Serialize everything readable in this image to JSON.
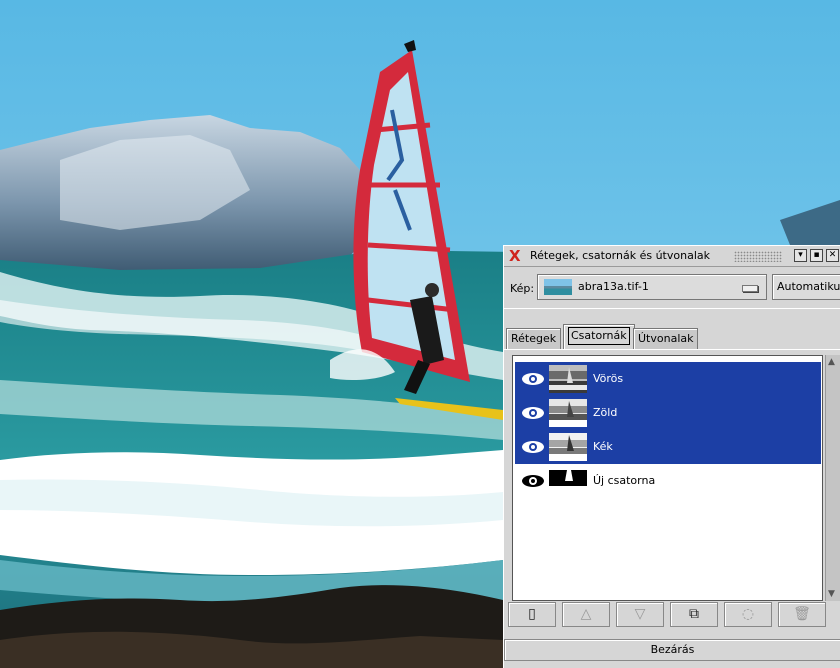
{
  "window": {
    "title": "Rétegek, csatornák és útvonalak",
    "image_label": "Kép:",
    "image_value": "abra13a.tif-1",
    "auto_label": "Automatikus",
    "tabs": [
      {
        "label": "Rétegek",
        "active": false
      },
      {
        "label": "Csatornák",
        "active": true
      },
      {
        "label": "Útvonalak",
        "active": false
      }
    ],
    "channels": [
      {
        "label": "Vörös",
        "selected": true
      },
      {
        "label": "Zöld",
        "selected": true
      },
      {
        "label": "Kék",
        "selected": true
      },
      {
        "label": "Új csatorna",
        "selected": false
      }
    ],
    "toolbar_icons": [
      "new-channel-icon",
      "raise-icon",
      "lower-icon",
      "duplicate-icon",
      "channel-to-selection-icon",
      "delete-icon"
    ],
    "close_label": "Bezárás"
  },
  "colors": {
    "selection": "#1c3fa5",
    "dialog_bg": "#d6d6d6",
    "title_x": "#d0241c"
  }
}
